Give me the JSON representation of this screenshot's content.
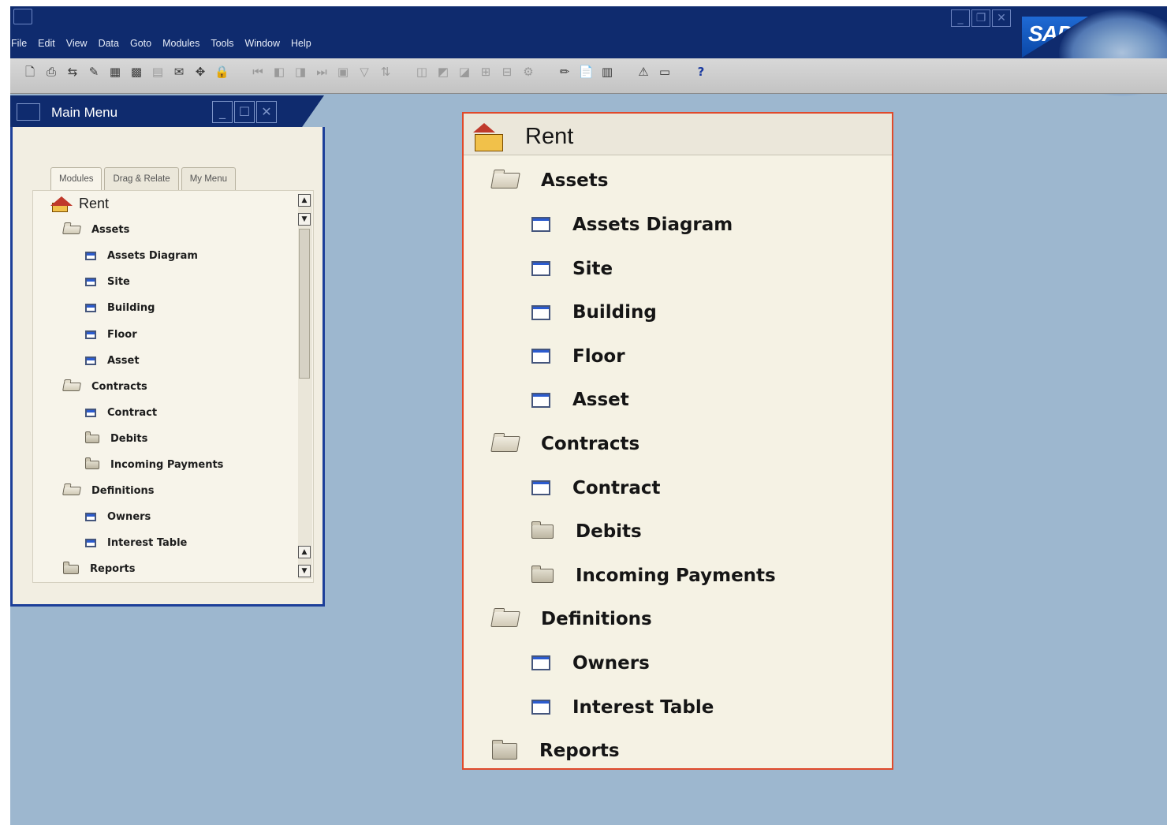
{
  "menubar": [
    "File",
    "Edit",
    "View",
    "Data",
    "Goto",
    "Modules",
    "Tools",
    "Window",
    "Help"
  ],
  "window_controls": [
    "minimize-icon",
    "restore-icon",
    "close-icon"
  ],
  "brand": "SAP",
  "toolbar": {
    "help_glyph": "?",
    "icons": [
      "preview-icon",
      "print-icon",
      "connect-icon",
      "attach-icon",
      "import-icon",
      "excel-icon",
      "word-icon",
      "send-icon",
      "pick-icon",
      "lock-icon",
      "first-record-icon",
      "prev-record-icon",
      "next-record-icon",
      "last-record-icon",
      "find-icon",
      "filter-icon",
      "sort-icon",
      "gross-profit-icon",
      "base-doc-icon",
      "target-doc-icon",
      "journal-icon",
      "trans-icon",
      "settings-icon",
      "edit-icon",
      "report-icon",
      "layout-icon",
      "alert-icon",
      "message-icon",
      "help-icon"
    ]
  },
  "main_menu": {
    "title": "Main Menu",
    "tabs": [
      "Modules",
      "Drag & Relate",
      "My Menu"
    ]
  },
  "tree": [
    {
      "label": "Rent",
      "type": "root",
      "level": 0
    },
    {
      "label": "Assets",
      "type": "folder-open",
      "level": 1
    },
    {
      "label": "Assets Diagram",
      "type": "form",
      "level": 2
    },
    {
      "label": "Site",
      "type": "form",
      "level": 2
    },
    {
      "label": "Building",
      "type": "form",
      "level": 2
    },
    {
      "label": "Floor",
      "type": "form",
      "level": 2
    },
    {
      "label": "Asset",
      "type": "form",
      "level": 2
    },
    {
      "label": "Contracts",
      "type": "folder-open",
      "level": 1
    },
    {
      "label": "Contract",
      "type": "form",
      "level": 2
    },
    {
      "label": "Debits",
      "type": "folder",
      "level": 2
    },
    {
      "label": "Incoming Payments",
      "type": "folder",
      "level": 2
    },
    {
      "label": "Definitions",
      "type": "folder-open",
      "level": 1
    },
    {
      "label": "Owners",
      "type": "form",
      "level": 2
    },
    {
      "label": "Interest Table",
      "type": "form",
      "level": 2
    },
    {
      "label": "Reports",
      "type": "folder",
      "level": 1
    }
  ],
  "colors": {
    "title_bar": "#0f2b6e",
    "desktop": "#9db7cf",
    "highlight_border": "#e04a2b",
    "panel_bg": "#f5f2e4"
  }
}
